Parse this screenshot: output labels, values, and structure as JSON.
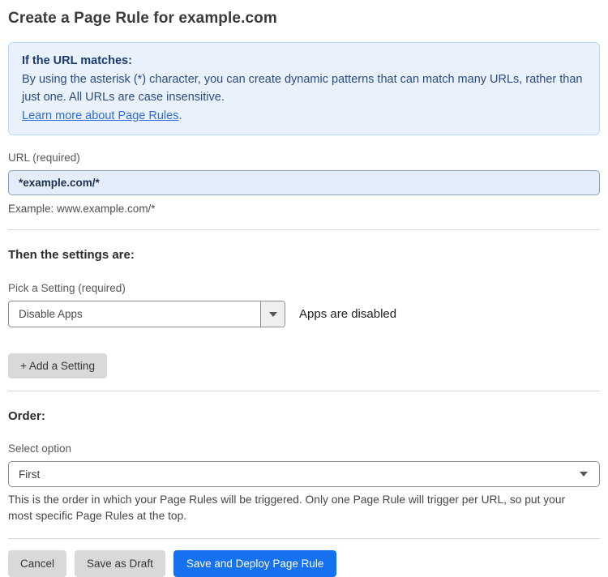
{
  "page": {
    "title": "Create a Page Rule for example.com"
  },
  "info_box": {
    "heading": "If the URL matches:",
    "body": "By using the asterisk (*) character, you can create dynamic patterns that can match many URLs, rather than just one. All URLs are case insensitive.",
    "link_label": "Learn more about Page Rules",
    "link_suffix": "."
  },
  "url_field": {
    "label": "URL (required)",
    "value": "*example.com/*",
    "helper": "Example: www.example.com/*"
  },
  "settings_section": {
    "heading": "Then the settings are:",
    "setting_label": "Pick a Setting (required)",
    "setting_value": "Disable Apps",
    "setting_status": "Apps are disabled",
    "add_setting_label": "+ Add a Setting"
  },
  "order_section": {
    "heading": "Order:",
    "label": "Select option",
    "value": "First",
    "helper": "This is the order in which your Page Rules will be triggered. Only one Page Rule will trigger per URL, so put your most specific Page Rules at the top."
  },
  "footer": {
    "cancel_label": "Cancel",
    "save_draft_label": "Save as Draft",
    "save_deploy_label": "Save and Deploy Page Rule"
  },
  "colors": {
    "accent_blue": "#1671ee",
    "info_background": "#e9f2fc",
    "info_border": "#b9d7f3",
    "info_text": "#2b4a80",
    "link_blue": "#2f6bd8",
    "url_input_background": "#e4eefb",
    "button_gray": "#d9d9d9"
  },
  "icons": {
    "dropdown_arrow": "caret-down"
  }
}
